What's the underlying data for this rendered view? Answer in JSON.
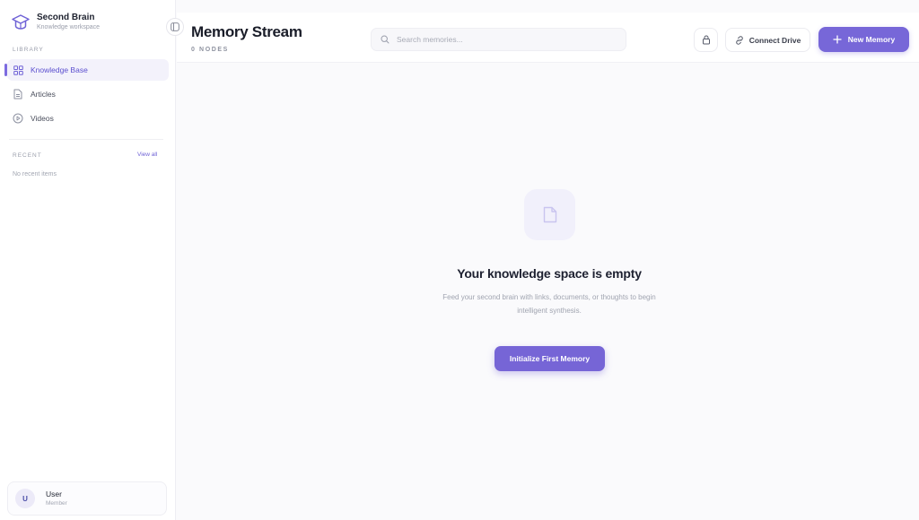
{
  "brand": {
    "title": "Second Brain",
    "subtitle": "Knowledge workspace"
  },
  "sidebar": {
    "library_label": "LIBRARY",
    "items": [
      {
        "label": "Knowledge Base",
        "icon": "grid-icon",
        "active": true
      },
      {
        "label": "Articles",
        "icon": "document-icon",
        "active": false
      },
      {
        "label": "Videos",
        "icon": "play-circle-icon",
        "active": false
      }
    ],
    "recent_label": "RECENT",
    "view_all": "View all",
    "recent_empty": "No recent items"
  },
  "user": {
    "initial": "U",
    "name": "User",
    "role": "Member"
  },
  "header": {
    "title": "Memory Stream",
    "node_count": "0 NODES",
    "search_placeholder": "Search memories...",
    "connect_label": "Connect Drive",
    "new_label": "New Memory"
  },
  "empty_state": {
    "title": "Your knowledge space is empty",
    "description": "Feed your second brain with links, documents, or thoughts to begin intelligent synthesis.",
    "button": "Initialize First Memory"
  },
  "colors": {
    "accent": "#7767d8",
    "accent_soft": "#f1f0fb"
  }
}
